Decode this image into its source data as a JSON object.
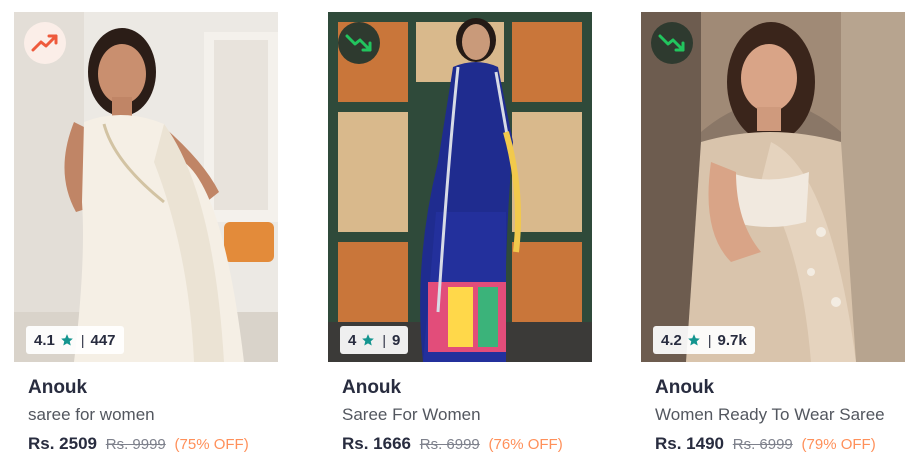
{
  "products": [
    {
      "trend": "up",
      "trend_icon": "trending-up-icon",
      "rating": "4.1",
      "rating_count": "447",
      "brand": "Anouk",
      "description": "saree for women",
      "price": "Rs. 2509",
      "mrp": "Rs. 9999",
      "discount": "(75% OFF)"
    },
    {
      "trend": "down",
      "trend_icon": "trending-down-icon",
      "rating": "4",
      "rating_count": "9",
      "brand": "Anouk",
      "description": "Saree For Women",
      "price": "Rs. 1666",
      "mrp": "Rs. 6999",
      "discount": "(76% OFF)"
    },
    {
      "trend": "down",
      "trend_icon": "trending-down-icon",
      "rating": "4.2",
      "rating_count": "9.7k",
      "brand": "Anouk",
      "description": "Women Ready To Wear Saree",
      "price": "Rs. 1490",
      "mrp": "Rs. 6999",
      "discount": "(79% OFF)"
    }
  ],
  "colors": {
    "star": "#14958f",
    "trend_up": "#ee5a3c",
    "trend_down": "#22c55e",
    "discount": "#ff905a",
    "text": "#282c3f"
  }
}
